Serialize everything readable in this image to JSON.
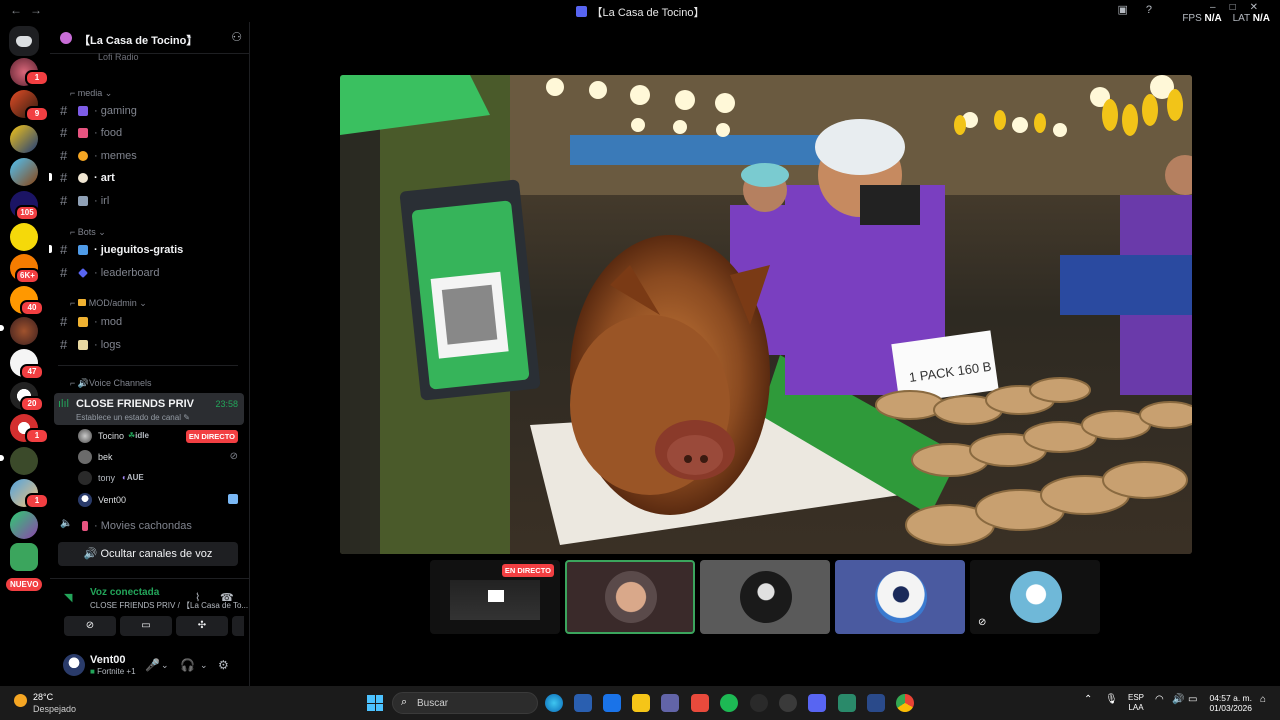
{
  "window": {
    "title": "【La Casa de Tocino】",
    "nav_back": "←",
    "nav_forward": "→",
    "fps_label": "FPS",
    "fps_value": "N/A",
    "lat_label": "LAT",
    "lat_value": "N/A",
    "minimize": "–",
    "maximize": "□",
    "close": "✕"
  },
  "rail": {
    "badges": [
      "1",
      "9",
      "105",
      "6K+",
      "40",
      "47",
      "20",
      "1",
      "1"
    ],
    "new_label": "NUEVO"
  },
  "sidebar": {
    "server_name": "【La Casa de Tocino】",
    "top_channel": "Lofi Radio",
    "categories": {
      "media": "media",
      "bots": "Bots",
      "mod": "MOD/admin",
      "voice": "Voice Channels"
    },
    "channels": [
      {
        "name": "gaming",
        "bold": false
      },
      {
        "name": "food",
        "bold": false
      },
      {
        "name": "memes",
        "bold": false
      },
      {
        "name": "art",
        "bold": true
      },
      {
        "name": "irl",
        "bold": false
      },
      {
        "name": "jueguitos-gratis",
        "bold": true
      },
      {
        "name": "leaderboard",
        "bold": false
      },
      {
        "name": "mod",
        "bold": false
      },
      {
        "name": "logs",
        "bold": false
      }
    ],
    "voice_channel": {
      "name": "CLOSE FRIENDS PRIV",
      "time": "23:58",
      "status": "Establece un estado de canal"
    },
    "voice_users": [
      {
        "name": "Tocino",
        "tag": "idle",
        "live": "EN DIRECTO"
      },
      {
        "name": "bek",
        "tag": ""
      },
      {
        "name": "tony",
        "tag": "AUE"
      },
      {
        "name": "Vent00",
        "tag": ""
      }
    ],
    "other_voice_channel": "Movies cachondas",
    "hide_voice_button": "Ocultar canales de voz"
  },
  "voice_status": {
    "title": "Voz conectada",
    "subtitle": "CLOSE FRIENDS PRIV / 【La Casa de To..."
  },
  "user": {
    "name": "Vent00",
    "status": "Fortnite +1"
  },
  "stream": {
    "live_label": "EN DIRECTO",
    "sign_text": "1 PACK 160 B"
  },
  "taskbar": {
    "temperature": "28°C",
    "weather": "Despejado",
    "search_placeholder": "Buscar",
    "lang_top": "ESP",
    "lang_bottom": "LAA",
    "time": "04:57 a. m.",
    "date": "01/03/2026"
  },
  "colors": {
    "accent_green": "#23a55a",
    "live_red": "#f23f42",
    "blurple": "#5865f2"
  }
}
